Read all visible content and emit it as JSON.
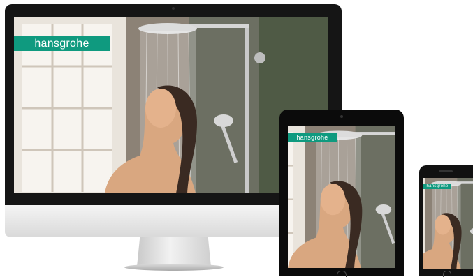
{
  "brand": {
    "name": "hansgrohe",
    "color": "#0f9a7f"
  },
  "devices": [
    "desktop",
    "tablet",
    "phone"
  ]
}
